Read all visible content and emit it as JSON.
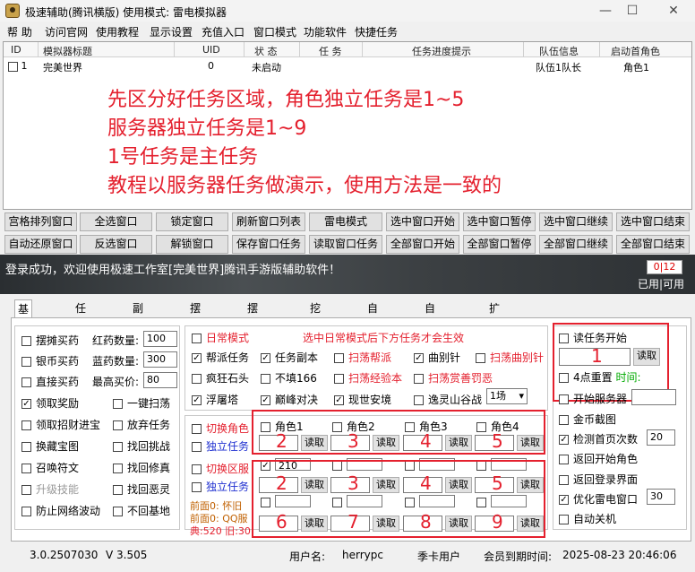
{
  "window": {
    "title": "极速辅助(腾讯横版)  使用模式: 雷电模拟器",
    "min": "—",
    "max": "☐",
    "close": "✕"
  },
  "menu": [
    "帮 助",
    "访问官网",
    "使用教程",
    "显示设置",
    "充值入口",
    "窗口模式",
    "功能软件",
    "快捷任务"
  ],
  "table": {
    "headers": [
      "ID",
      "模拟器标题",
      "UID",
      "状 态",
      "任 务",
      "任务进度提示",
      "队伍信息",
      "启动首角色"
    ],
    "rows": [
      {
        "id": "1",
        "title": "完美世界",
        "uid": "0",
        "status": "未启动",
        "task": "",
        "progress": "",
        "team": "队伍1队长",
        "role": "角色1"
      }
    ]
  },
  "notes": [
    "先区分好任务区域，角色独立任务是1~5",
    "服务器独立任务是1~9",
    "1号任务是主任务",
    "教程以服务器任务做演示，使用方法是一致的"
  ],
  "buttons_row1": [
    "宫格排列窗口",
    "全选窗口",
    "锁定窗口",
    "刷新窗口列表",
    "雷电模式",
    "选中窗口开始",
    "选中窗口暂停",
    "选中窗口继续",
    "选中窗口结束"
  ],
  "buttons_row2": [
    "自动还原窗口",
    "反选窗口",
    "解锁窗口",
    "保存窗口任务",
    "读取窗口任务",
    "全部窗口开始",
    "全部窗口暂停",
    "全部窗口继续",
    "全部窗口结束"
  ],
  "banner": {
    "message": "登录成功，欢迎使用极速工作室[完美世界]腾讯手游版辅助软件！",
    "counter": "0|12",
    "counter_label": "已用|可用"
  },
  "tabs": [
    "基本功能",
    "任务起号",
    "副本模式",
    "摆摊购买",
    "摆摊出售",
    "挖宝采集",
    "自动清包",
    "自动喊话",
    "扩展功能"
  ],
  "basic": {
    "left": [
      {
        "label": "摆摊买药",
        "checked": false
      },
      {
        "label": "银币买药",
        "checked": false
      },
      {
        "label": "直接买药",
        "checked": false
      },
      {
        "label": "领取奖励",
        "checked": true
      },
      {
        "label": "领取招财进宝",
        "checked": false
      },
      {
        "label": "换藏宝图",
        "checked": false
      },
      {
        "label": "召唤符文",
        "checked": false
      },
      {
        "label": "升级技能",
        "checked": false
      },
      {
        "label": "防止网络波动",
        "checked": false
      }
    ],
    "fields": [
      {
        "label": "红药数量:",
        "value": "100"
      },
      {
        "label": "蓝药数量:",
        "value": "300"
      },
      {
        "label": "最高买价:",
        "value": "80"
      }
    ],
    "mid": [
      {
        "label": "一键扫荡",
        "checked": false
      },
      {
        "label": "放弃任务",
        "checked": false
      },
      {
        "label": "找回挑战",
        "checked": false
      },
      {
        "label": "找回修真",
        "checked": false
      },
      {
        "label": "找回恶灵",
        "checked": false
      },
      {
        "label": "不回基地",
        "checked": false
      }
    ]
  },
  "daily": {
    "title": "日常模式",
    "hint": "选中日常模式后下方任务才会生效",
    "items": [
      {
        "label": "帮派任务",
        "checked": true
      },
      {
        "label": "任务副本",
        "checked": true
      },
      {
        "label": "扫荡帮派",
        "checked": false
      },
      {
        "label": "曲别针",
        "checked": true
      },
      {
        "label": "扫荡曲别针",
        "checked": false
      },
      {
        "label": "疯狂石头",
        "checked": false
      },
      {
        "label": "不填166",
        "checked": false
      },
      {
        "label": "扫荡经验本",
        "checked": false
      },
      {
        "label": "扫荡赏善罚恶",
        "checked": false
      },
      {
        "label": "浮屠塔",
        "checked": true
      },
      {
        "label": "巅峰对决",
        "checked": true
      },
      {
        "label": "现世安境",
        "checked": true
      },
      {
        "label": "逸灵山谷战",
        "checked": false
      }
    ],
    "select": "1场"
  },
  "roles": {
    "switch": "切换角色",
    "independent": "独立任务",
    "names": [
      "角色1",
      "角色2",
      "角色3",
      "角色4"
    ],
    "nums": [
      "2",
      "3",
      "4",
      "5"
    ],
    "read": "读取"
  },
  "servers": {
    "switch": "切换区服",
    "independent": "独立任务",
    "first_value": "210",
    "nums_row1": [
      "2",
      "3",
      "4",
      "5"
    ],
    "nums_row2": [
      "6",
      "7",
      "8",
      "9"
    ],
    "read": "读取",
    "info1": "前面0: 怀旧",
    "info2": "前面0: QQ服",
    "info3": "典:520 旧:30"
  },
  "right": {
    "read_start": "读任务开始",
    "task1": "1",
    "read": "读取",
    "reset": "4点重置",
    "time": "时间:",
    "start_server": "开始服务器",
    "gold": "金币截图",
    "detect": "检测首页次数",
    "detect_val": "20",
    "return_role": "返回开始角色",
    "return_login": "返回登录界面",
    "optimize": "优化雷电窗口",
    "optimize_val": "30",
    "auto_off": "自动关机"
  },
  "status": {
    "version": "3.0.2507030",
    "v": "V 3.505",
    "user_label": "用户名:",
    "user": "herrypc",
    "type": "季卡用户",
    "expire_label": "会员到期时间:",
    "expire": "2025-08-23 20:46:06"
  }
}
